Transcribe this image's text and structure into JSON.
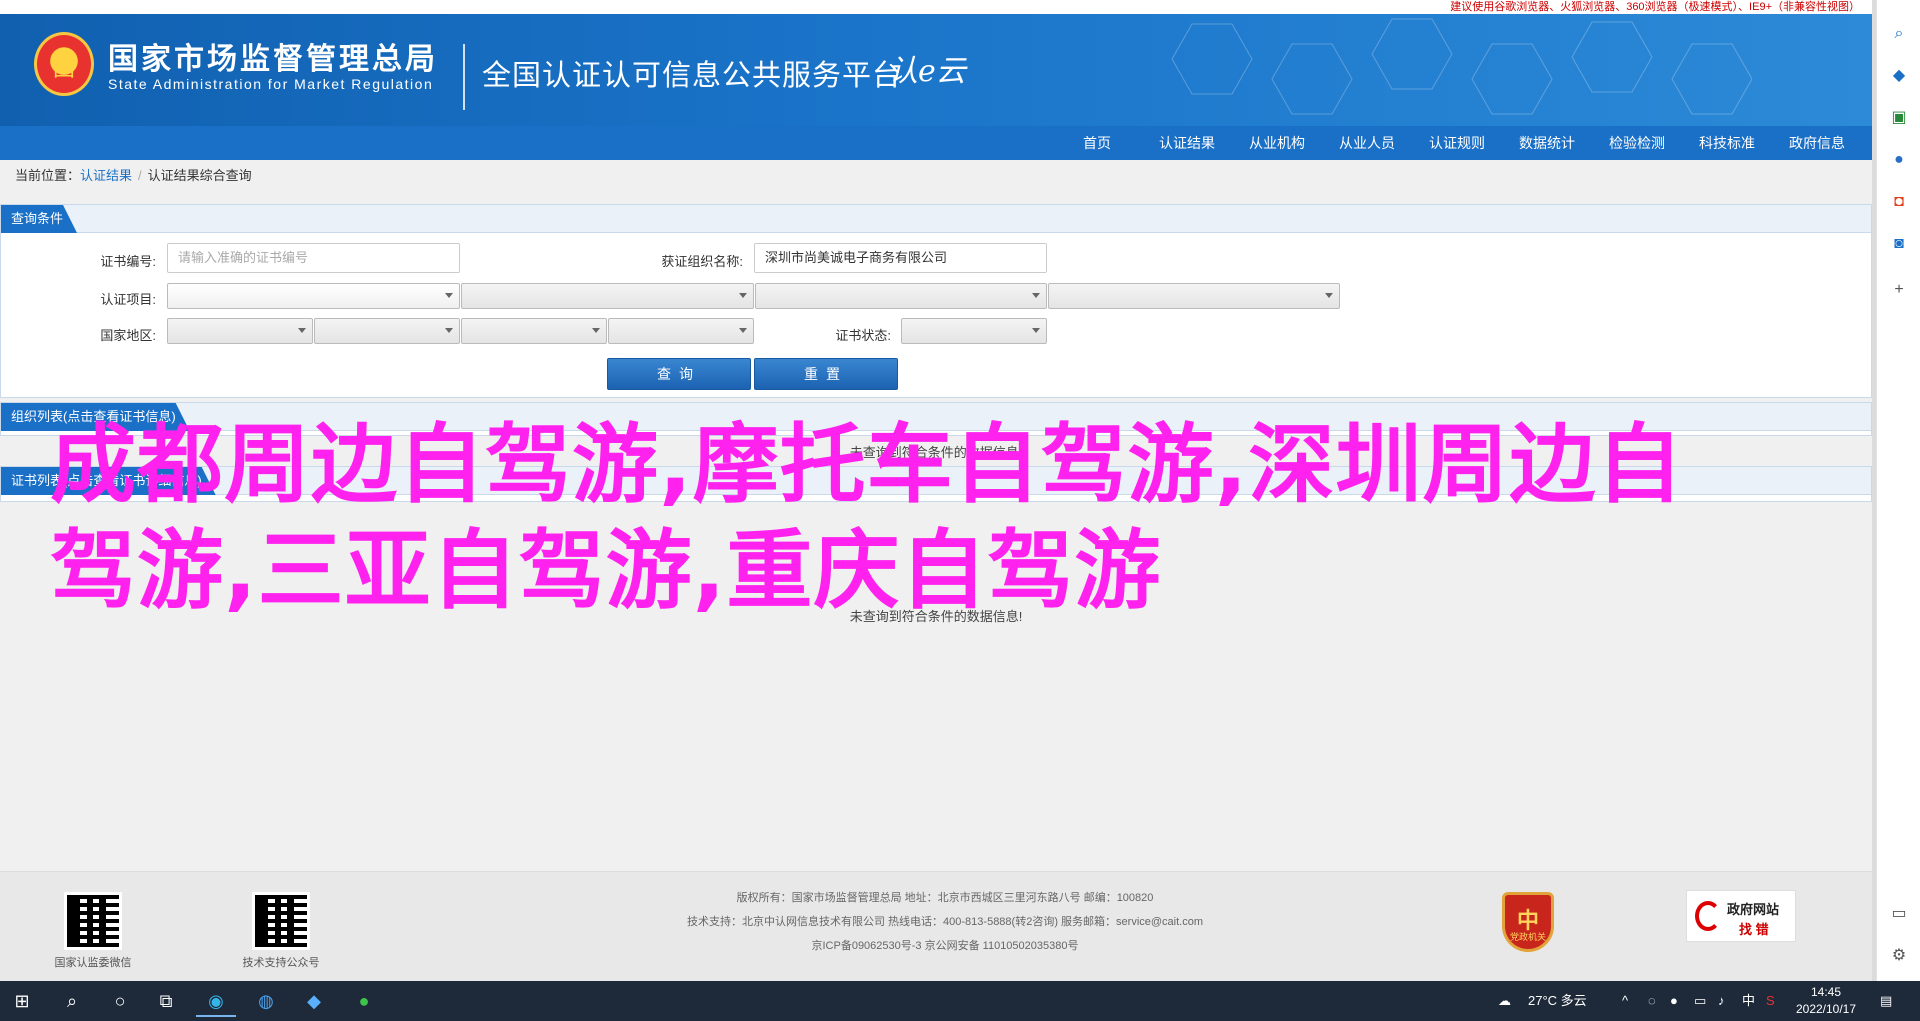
{
  "browser_note": "建议使用谷歌浏览器、火狐浏览器、360浏览器（极速模式）、IE9+（非兼容性视图）",
  "header": {
    "org_cn": "国家市场监督管理总局",
    "org_en": "State Administration  for  Market Regulation",
    "platform": "全国认证认可信息公共服务平台",
    "logo_script": "认e云",
    "emblem": "国"
  },
  "nav": [
    "首页",
    "认证结果",
    "从业机构",
    "从业人员",
    "认证规则",
    "数据统计",
    "检验检测",
    "科技标准",
    "政府信息"
  ],
  "breadcrumb": {
    "prefix": "当前位置：",
    "link": "认证结果",
    "sep": "/",
    "current": "认证结果综合查询"
  },
  "query": {
    "tab": "查询条件",
    "cert_no_label": "证书编号:",
    "cert_no_placeholder": "请输入准确的证书编号",
    "org_label": "获证组织名称:",
    "org_value": "深圳市尚美诚电子商务有限公司",
    "item_label": "认证项目:",
    "region_label": "国家地区:",
    "status_label": "证书状态:",
    "search_btn": "查询",
    "reset_btn": "重置"
  },
  "org_list": {
    "tab": "组织列表(点击查看证书信息)"
  },
  "cert_list": {
    "tab": "证书列表(点击查看证书详细信息)",
    "empty": "未查询到符合条件的数据信息!"
  },
  "overlay_text": "成都周边自驾游,摩托车自驾游,深圳周边自驾游,三亚自驾游,重庆自驾游",
  "footer": {
    "qr1_caption": "国家认监委微信",
    "qr2_caption": "技术支持公众号",
    "line1": "版权所有：国家市场监督管理总局    地址：北京市西城区三里河东路八号    邮编：100820",
    "line2": "技术支持：北京中认网信息技术有限公司    热线电话：400-813-5888(转2咨询)    服务邮箱：service@cait.com",
    "line3": "京ICP备09062530号-3    京公网安备 11010502035380号",
    "badge": "党政机关",
    "badge_glyph": "中",
    "gov_t1": "政府网站",
    "gov_t2": "找 错"
  },
  "taskbar": {
    "weather": "27°C  多云",
    "ime": "中",
    "time": "14:45",
    "date": "2022/10/17"
  }
}
